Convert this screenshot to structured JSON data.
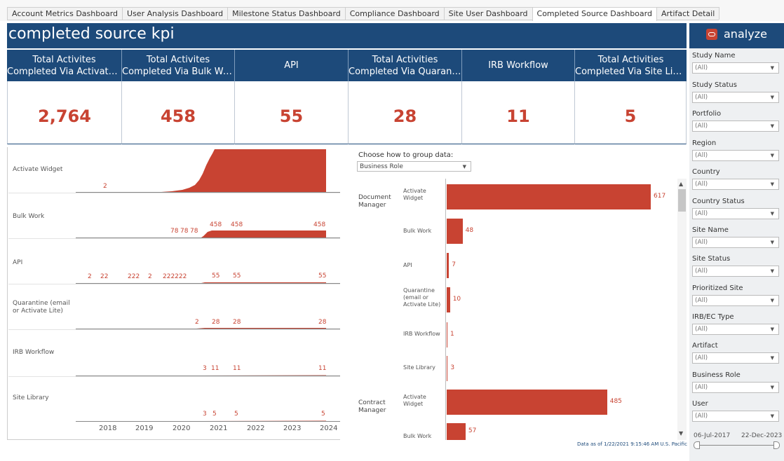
{
  "tabs": [
    {
      "label": "Account Metrics Dashboard",
      "active": false
    },
    {
      "label": "User Analysis Dashboard",
      "active": false
    },
    {
      "label": "Milestone Status Dashboard",
      "active": false
    },
    {
      "label": "Compliance Dashboard",
      "active": false
    },
    {
      "label": "Site User Dashboard",
      "active": false
    },
    {
      "label": "Completed Source Dashboard",
      "active": true
    },
    {
      "label": "Artifact Detail",
      "active": false
    }
  ],
  "title": "completed source kpi",
  "kpis": [
    {
      "header": "Total Activites\nCompleted Via Activate ..",
      "value": "2,764"
    },
    {
      "header": "Total Activites\nCompleted Via Bulk Work",
      "value": "458"
    },
    {
      "header": "API",
      "value": "55"
    },
    {
      "header": "Total Activities\nCompleted Via Quaranti..",
      "value": "28"
    },
    {
      "header": "IRB Workflow",
      "value": "11"
    },
    {
      "header": "Total Activities\nCompleted Via Site Libr..",
      "value": "5"
    }
  ],
  "timeline": {
    "rows": [
      {
        "label": "Activate Widget",
        "labels": [
          "2"
        ]
      },
      {
        "label": "Bulk Work",
        "labels": [
          "78",
          "78",
          "78",
          "458",
          "458",
          "458"
        ]
      },
      {
        "label": "API",
        "labels": [
          "2",
          "22",
          "222",
          "2",
          "222222",
          "55",
          "55",
          "55"
        ]
      },
      {
        "label": "Quarantine (email or Activate Lite)",
        "labels": [
          "2",
          "28",
          "28",
          "28"
        ]
      },
      {
        "label": "IRB Workflow",
        "labels": [
          "3",
          "11",
          "11",
          "11"
        ]
      },
      {
        "label": "Site Library",
        "labels": [
          "3",
          "5",
          "5",
          "5"
        ]
      }
    ],
    "years": [
      "2018",
      "2019",
      "2020",
      "2021",
      "2022",
      "2023",
      "2024"
    ]
  },
  "grouping": {
    "prompt": "Choose how to group data:",
    "selected": "Business Role"
  },
  "chart_data": {
    "type": "bar",
    "orientation": "horizontal",
    "groups": [
      {
        "name": "Document Manager",
        "categories": [
          "Activate Widget",
          "Bulk Work",
          "API",
          "Quarantine (email or Activate Lite)",
          "IRB Workflow",
          "Site Library"
        ],
        "values": [
          617,
          48,
          7,
          10,
          1,
          3
        ]
      },
      {
        "name": "Contract Manager",
        "categories": [
          "Activate Widget",
          "Bulk Work"
        ],
        "values": [
          485,
          57
        ]
      }
    ]
  },
  "footnote": "Data as of 1/22/2021 9:15:46 AM U.S. Pacific",
  "logo": "analyze",
  "filters": [
    {
      "label": "Study Name",
      "value": "(All)"
    },
    {
      "label": "Study Status",
      "value": "(All)"
    },
    {
      "label": "Portfolio",
      "value": "(All)"
    },
    {
      "label": "Region",
      "value": "(All)"
    },
    {
      "label": "Country",
      "value": "(All)"
    },
    {
      "label": "Country Status",
      "value": "(All)"
    },
    {
      "label": "Site Name",
      "value": "(All)"
    },
    {
      "label": "Site Status",
      "value": "(All)"
    },
    {
      "label": "Prioritized Site",
      "value": "(All)"
    },
    {
      "label": "IRB/EC Type",
      "value": "(All)"
    },
    {
      "label": "Artifact",
      "value": "(All)"
    },
    {
      "label": "Business Role",
      "value": "(All)"
    },
    {
      "label": "User",
      "value": "(All)"
    }
  ],
  "date_range": {
    "start": "06-Jul-2017",
    "end": "22-Dec-2023"
  },
  "colors": {
    "accent": "#c84332",
    "header": "#1d4a7a"
  }
}
